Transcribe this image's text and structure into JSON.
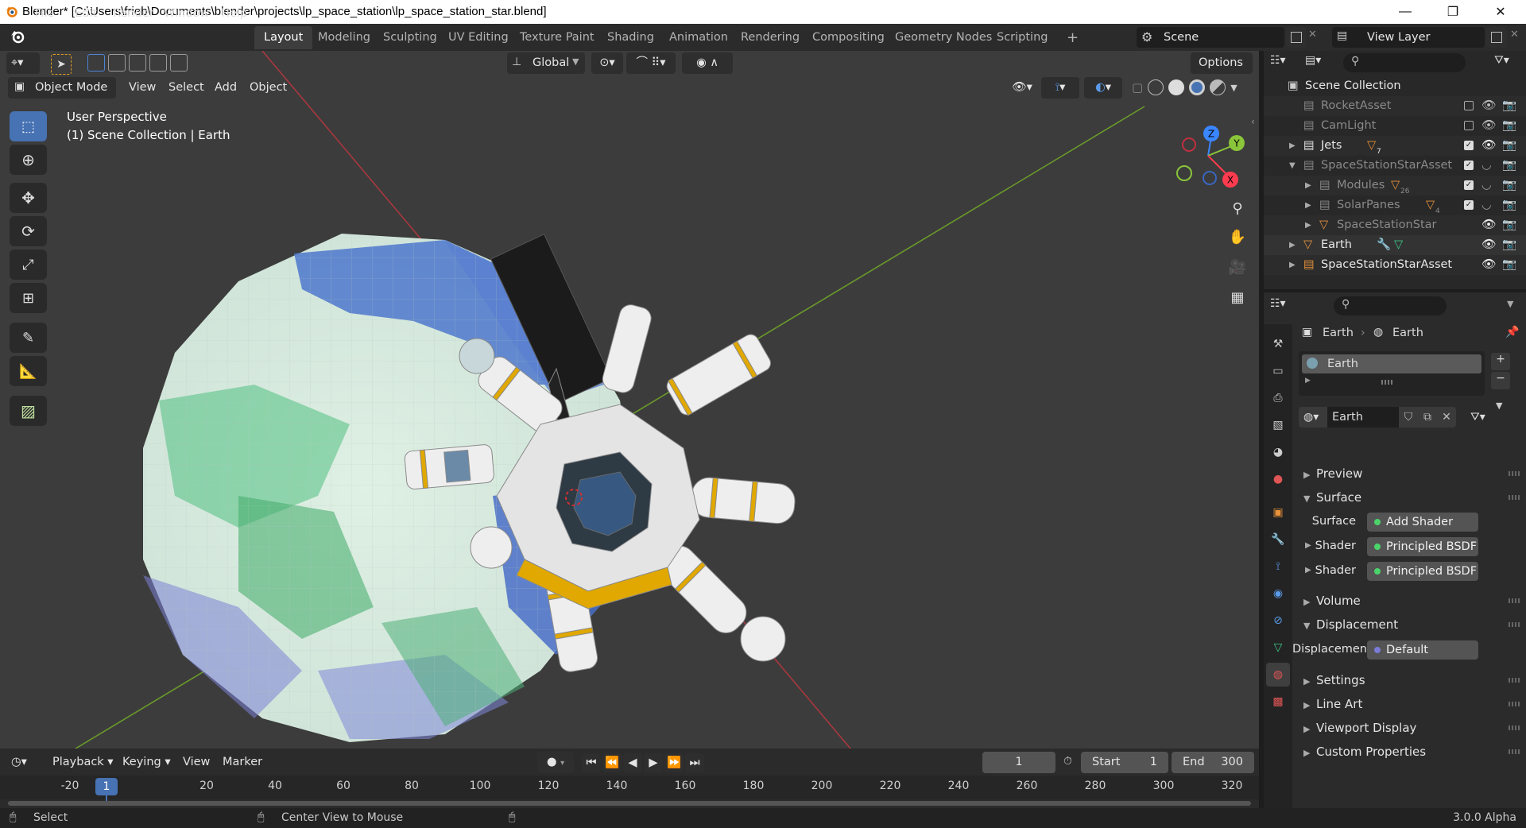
{
  "window": {
    "title": "Blender* [C:\\Users\\frieb\\Documents\\blender\\projects\\lp_space_station\\lp_space_station_star.blend]",
    "controls": {
      "minimize": "—",
      "maximize": "❐",
      "close": "✕"
    }
  },
  "menu": {
    "items": [
      "File",
      "Edit",
      "Render",
      "Window",
      "Help"
    ]
  },
  "workspaces": {
    "tabs": [
      "Layout",
      "Modeling",
      "Sculpting",
      "UV Editing",
      "Texture Paint",
      "Shading",
      "Animation",
      "Rendering",
      "Compositing",
      "Geometry Nodes",
      "Scripting"
    ],
    "active": "Layout",
    "add": "+"
  },
  "scene": {
    "name": "Scene"
  },
  "view_layer": {
    "name": "View Layer"
  },
  "viewport": {
    "header": {
      "orientation": "Global",
      "options": "Options",
      "mode": "Object Mode",
      "menus": [
        "View",
        "Select",
        "Add",
        "Object"
      ]
    },
    "overlay": {
      "line1": "User Perspective",
      "line2": "(1) Scene Collection | Earth"
    },
    "gizmo": {
      "z": "Z",
      "y": "Y",
      "x": "X"
    }
  },
  "outliner": {
    "root": "Scene Collection",
    "rows": [
      {
        "label": "RocketAsset",
        "dim": true
      },
      {
        "label": "CamLight",
        "dim": true
      },
      {
        "label": "Jets",
        "dim": false,
        "badge": "7"
      },
      {
        "label": "SpaceStationStarAsset",
        "dim": true
      },
      {
        "label": "Modules",
        "dim": true,
        "badge": "26"
      },
      {
        "label": "SolarPanes",
        "dim": true,
        "badge": "4"
      },
      {
        "label": "SpaceStationStar",
        "dim": true
      },
      {
        "label": "Earth",
        "dim": false
      },
      {
        "label": "SpaceStationStarAsset",
        "dim": false
      }
    ]
  },
  "properties": {
    "breadcrumb": {
      "object": "Earth",
      "material": "Earth"
    },
    "slot": "Earth",
    "material_name": "Earth",
    "sections": {
      "preview": "Preview",
      "surface": "Surface",
      "volume": "Volume",
      "displacement": "Displacement",
      "settings": "Settings",
      "line_art": "Line Art",
      "viewport_display": "Viewport Display",
      "custom_properties": "Custom Properties"
    },
    "surface_row": {
      "key": "Surface",
      "value": "Add Shader"
    },
    "shader_rows": [
      {
        "key": "Shader",
        "value": "Principled BSDF"
      },
      {
        "key": "Shader",
        "value": "Principled BSDF"
      }
    ],
    "displacement_row": {
      "key": "Displacement",
      "value": "Default"
    }
  },
  "timeline": {
    "menus": [
      "Playback",
      "Keying",
      "View",
      "Marker"
    ],
    "current_frame": "1",
    "start_label": "Start",
    "start": "1",
    "end_label": "End",
    "end": "300",
    "ticks": [
      "-20",
      "20",
      "40",
      "60",
      "80",
      "100",
      "120",
      "140",
      "160",
      "180",
      "200",
      "220",
      "240",
      "260",
      "280",
      "300",
      "320"
    ]
  },
  "status": {
    "left": "Select",
    "middle": "Center View to Mouse",
    "version": "3.0.0 Alpha"
  }
}
